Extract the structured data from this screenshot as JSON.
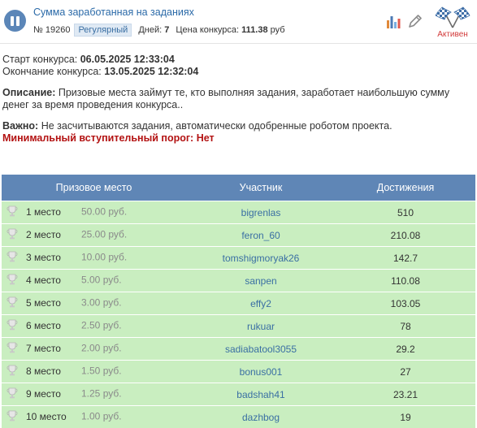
{
  "header": {
    "title": "Сумма заработанная на заданиях",
    "id_label": "№ 19260",
    "type_badge": "Регулярный",
    "days_label": "Дней:",
    "days_value": "7",
    "price_label": "Цена конкурса:",
    "price_value": "111.38",
    "price_unit": "руб",
    "status_label": "Активен",
    "icons": [
      "pause-icon",
      "stats-icon",
      "edit-icon",
      "checkered-flags-icon"
    ]
  },
  "info": {
    "start_label": "Старт конкурса:",
    "start_value": "06.05.2025 12:33:04",
    "end_label": "Окончание конкурса:",
    "end_value": "13.05.2025 12:32:04",
    "description_label": "Описание:",
    "description_text": "Призовые места займут те, кто выполняя задания, заработает наибольшую сумму денег за время проведения конкурса..",
    "important_label": "Важно:",
    "important_text": "Не засчитываются задания, автоматически одобренные роботом проекта.",
    "threshold": "Минимальный вступительный порог: Нет"
  },
  "table": {
    "headers": [
      "Призовое место",
      "Участник",
      "Достижения"
    ],
    "rows": [
      {
        "place": "1 место",
        "prize": "50.00 руб.",
        "user": "bigrenlas",
        "achievement": "510"
      },
      {
        "place": "2 место",
        "prize": "25.00 руб.",
        "user": "feron_60",
        "achievement": "210.08"
      },
      {
        "place": "3 место",
        "prize": "10.00 руб.",
        "user": "tomshigmoryak26",
        "achievement": "142.7"
      },
      {
        "place": "4 место",
        "prize": "5.00 руб.",
        "user": "sanpen",
        "achievement": "110.08"
      },
      {
        "place": "5 место",
        "prize": "3.00 руб.",
        "user": "effy2",
        "achievement": "103.05"
      },
      {
        "place": "6 место",
        "prize": "2.50 руб.",
        "user": "rukuar",
        "achievement": "78"
      },
      {
        "place": "7 место",
        "prize": "2.00 руб.",
        "user": "sadiabatool3055",
        "achievement": "29.2"
      },
      {
        "place": "8 место",
        "prize": "1.50 руб.",
        "user": "bonus001",
        "achievement": "27"
      },
      {
        "place": "9 место",
        "prize": "1.25 руб.",
        "user": "badshah41",
        "achievement": "23.21"
      },
      {
        "place": "10 место",
        "prize": "1.00 руб.",
        "user": "dazhbog",
        "achievement": "19"
      }
    ]
  },
  "colors": {
    "accent": "#5f86b6",
    "row_bg": "#c9eec0",
    "link": "#3a6fa3",
    "threshold": "#b31212",
    "active": "#d23a3a"
  }
}
